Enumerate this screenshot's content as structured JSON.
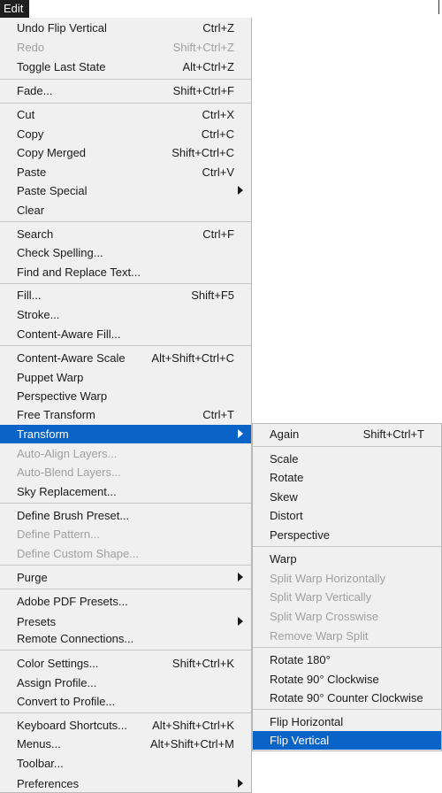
{
  "menubar": {
    "edit_label": "Edit"
  },
  "main_menu": {
    "undo": {
      "label": "Undo Flip Vertical",
      "shortcut": "Ctrl+Z"
    },
    "redo": {
      "label": "Redo",
      "shortcut": "Shift+Ctrl+Z"
    },
    "toggle_last_state": {
      "label": "Toggle Last State",
      "shortcut": "Alt+Ctrl+Z"
    },
    "fade": {
      "label": "Fade...",
      "shortcut": "Shift+Ctrl+F"
    },
    "cut": {
      "label": "Cut",
      "shortcut": "Ctrl+X"
    },
    "copy": {
      "label": "Copy",
      "shortcut": "Ctrl+C"
    },
    "copy_merged": {
      "label": "Copy Merged",
      "shortcut": "Shift+Ctrl+C"
    },
    "paste": {
      "label": "Paste",
      "shortcut": "Ctrl+V"
    },
    "paste_special": {
      "label": "Paste Special"
    },
    "clear": {
      "label": "Clear"
    },
    "search": {
      "label": "Search",
      "shortcut": "Ctrl+F"
    },
    "check_spelling": {
      "label": "Check Spelling..."
    },
    "find_replace": {
      "label": "Find and Replace Text..."
    },
    "fill": {
      "label": "Fill...",
      "shortcut": "Shift+F5"
    },
    "stroke": {
      "label": "Stroke..."
    },
    "content_aware_fill": {
      "label": "Content-Aware Fill..."
    },
    "content_aware_scale": {
      "label": "Content-Aware Scale",
      "shortcut": "Alt+Shift+Ctrl+C"
    },
    "puppet_warp": {
      "label": "Puppet Warp"
    },
    "perspective_warp": {
      "label": "Perspective Warp"
    },
    "free_transform": {
      "label": "Free Transform",
      "shortcut": "Ctrl+T"
    },
    "transform": {
      "label": "Transform"
    },
    "auto_align": {
      "label": "Auto-Align Layers..."
    },
    "auto_blend": {
      "label": "Auto-Blend Layers..."
    },
    "sky_replacement": {
      "label": "Sky Replacement..."
    },
    "define_brush": {
      "label": "Define Brush Preset..."
    },
    "define_pattern": {
      "label": "Define Pattern..."
    },
    "define_custom_shape": {
      "label": "Define Custom Shape..."
    },
    "purge": {
      "label": "Purge"
    },
    "adobe_pdf_presets": {
      "label": "Adobe PDF Presets..."
    },
    "presets": {
      "label": "Presets"
    },
    "remote_connections": {
      "label": "Remote Connections..."
    },
    "color_settings": {
      "label": "Color Settings...",
      "shortcut": "Shift+Ctrl+K"
    },
    "assign_profile": {
      "label": "Assign Profile..."
    },
    "convert_profile": {
      "label": "Convert to Profile..."
    },
    "keyboard_shortcuts": {
      "label": "Keyboard Shortcuts...",
      "shortcut": "Alt+Shift+Ctrl+K"
    },
    "menus": {
      "label": "Menus...",
      "shortcut": "Alt+Shift+Ctrl+M"
    },
    "toolbar": {
      "label": "Toolbar..."
    },
    "preferences": {
      "label": "Preferences"
    }
  },
  "transform_submenu": {
    "again": {
      "label": "Again",
      "shortcut": "Shift+Ctrl+T"
    },
    "scale": {
      "label": "Scale"
    },
    "rotate": {
      "label": "Rotate"
    },
    "skew": {
      "label": "Skew"
    },
    "distort": {
      "label": "Distort"
    },
    "perspective": {
      "label": "Perspective"
    },
    "warp": {
      "label": "Warp"
    },
    "split_warp_h": {
      "label": "Split Warp Horizontally"
    },
    "split_warp_v": {
      "label": "Split Warp Vertically"
    },
    "split_warp_cross": {
      "label": "Split Warp Crosswise"
    },
    "remove_warp_split": {
      "label": "Remove Warp Split"
    },
    "rotate_180": {
      "label": "Rotate 180°"
    },
    "rotate_90_cw": {
      "label": "Rotate 90° Clockwise"
    },
    "rotate_90_ccw": {
      "label": "Rotate 90° Counter Clockwise"
    },
    "flip_h": {
      "label": "Flip Horizontal"
    },
    "flip_v": {
      "label": "Flip Vertical"
    }
  },
  "colors": {
    "highlight": "#0a64c8",
    "menu_bg": "#f0f0f0",
    "disabled_text": "#a0a0a0"
  },
  "icons": {
    "submenu_arrow": "chevron-right-icon"
  }
}
